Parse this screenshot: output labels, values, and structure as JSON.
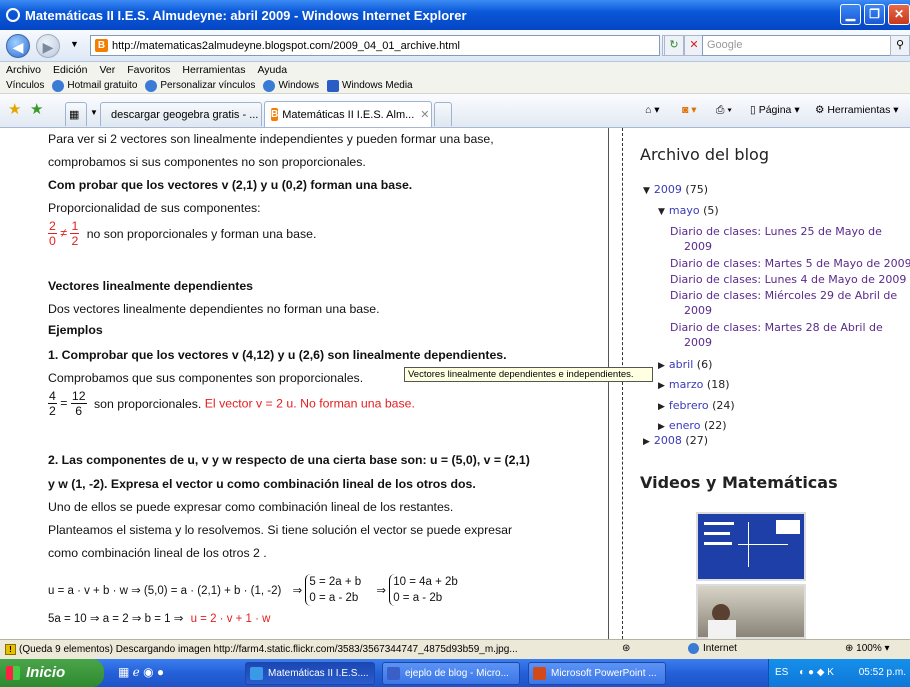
{
  "window": {
    "title": "Matemáticas II I.E.S. Almudeyne: abril 2009 - Windows Internet Explorer"
  },
  "nav": {
    "url": "http://matematicas2almudeyne.blogspot.com/2009_04_01_archive.html",
    "search_placeholder": "Google"
  },
  "menu": [
    "Archivo",
    "Edición",
    "Ver",
    "Favoritos",
    "Herramientas",
    "Ayuda"
  ],
  "links": {
    "label": "Vínculos",
    "items": [
      "Hotmail gratuito",
      "Personalizar vínculos",
      "Windows",
      "Windows Media"
    ]
  },
  "tabs": [
    {
      "label": "descargar geogebra gratis - ..."
    },
    {
      "label": "Matemáticas II I.E.S. Alm..."
    }
  ],
  "commandbar": {
    "page": "Página",
    "tools": "Herramientas"
  },
  "article": {
    "l1": "Para ver si 2 vectores son linealmente independientes y pueden formar una base,",
    "l2": "comprobamos si sus componentes  no son proporcionales.",
    "l3": "Com probar que los vectores v (2,1) y u (0,2) forman una base.",
    "l4": "Proporcionalidad de sus componentes:",
    "f1n": "2",
    "f1d": "0",
    "neq": "≠",
    "f2n": "1",
    "f2d": "2",
    "l5": "no son proporcionales y forman una base.",
    "l6": "Vectores linealmente dependientes",
    "l7": "Dos vectores linealmente  dependientes no forman una base.",
    "l8": "Ejemplos",
    "l9": "1.  Comprobar que los vectores v (4,12) y u (2,6) son linealmente dependientes.",
    "l10": "Comprobamos que sus componentes son proporcionales.",
    "f3n": "4",
    "f3d": "2",
    "eq": "=",
    "f4n": "12",
    "f4d": "6",
    "l11a": "son proporcionales.",
    "l11b": "El vector v = 2 u. No forman una base.",
    "l12": "2.  Las componentes de u, v y w respecto de una cierta base son: u = (5,0), v = (2,1)",
    "l13": " y w (1, -2).  Expresa el vector u como combinación lineal de los otros dos.",
    "l14": "Uno de ellos se puede expresar como combinación lineal de los restantes.",
    "l15": "Planteamos el sistema y lo resolvemos. Si tiene solución el vector se puede expresar",
    "l16": "como combinación lineal de los otros 2 .",
    "eq1": "u = a · v + b · w   ⇒   (5,0) = a · (2,1) + b · (1, -2)",
    "sys1a": "5 = 2a + b",
    "sys1b": "0 =  a -  2b",
    "sys2a": "10 = 4a + 2b",
    "sys2b": "0  =  a - 2b",
    "eq2": "5a = 10 ⇒ a = 2 ⇒ b = 1    ⇒",
    "eq2r": "u = 2 · v + 1 · w"
  },
  "tooltip": "Vectores linealmente dependientes e independientes.",
  "sidebar": {
    "archive_title": "Archivo del blog",
    "y2009": "2009",
    "y2009c": "(75)",
    "mayo": "mayo",
    "mayoc": "(5)",
    "posts": [
      "Diario de clases: Lunes 25 de Mayo de",
      "2009",
      "Diario de clases: Martes 5 de Mayo de 2009",
      "Diario de clases: Lunes 4 de Mayo de 2009",
      "Diario de clases: Miércoles 29 de Abril de",
      "2009",
      "Diario de clases: Martes 28 de Abril de",
      "2009"
    ],
    "months": [
      {
        "name": "abril",
        "count": "(6)"
      },
      {
        "name": "marzo",
        "count": "(18)"
      },
      {
        "name": "febrero",
        "count": "(24)"
      },
      {
        "name": "enero",
        "count": "(22)"
      }
    ],
    "y2008": "2008",
    "y2008c": "(27)",
    "videos_title": "Videos y Matemáticas"
  },
  "status": {
    "text": "(Queda 9 elementos) Descargando imagen http://farm4.static.flickr.com/3583/3567344747_4875d93b59_m.jpg...",
    "zone": "Internet",
    "zoom": "100%"
  },
  "taskbar": {
    "start": "Inicio",
    "tasks": [
      "Matemáticas II I.E.S....",
      "ejeplo de blog - Micro...",
      "Microsoft PowerPoint ..."
    ],
    "lang": "ES",
    "clock": "05:52 p.m."
  },
  "colors": {
    "accent_red": "#e31e1e",
    "link_purple": "#5a2a8a",
    "titlebar_blue": "#0a58d8"
  }
}
